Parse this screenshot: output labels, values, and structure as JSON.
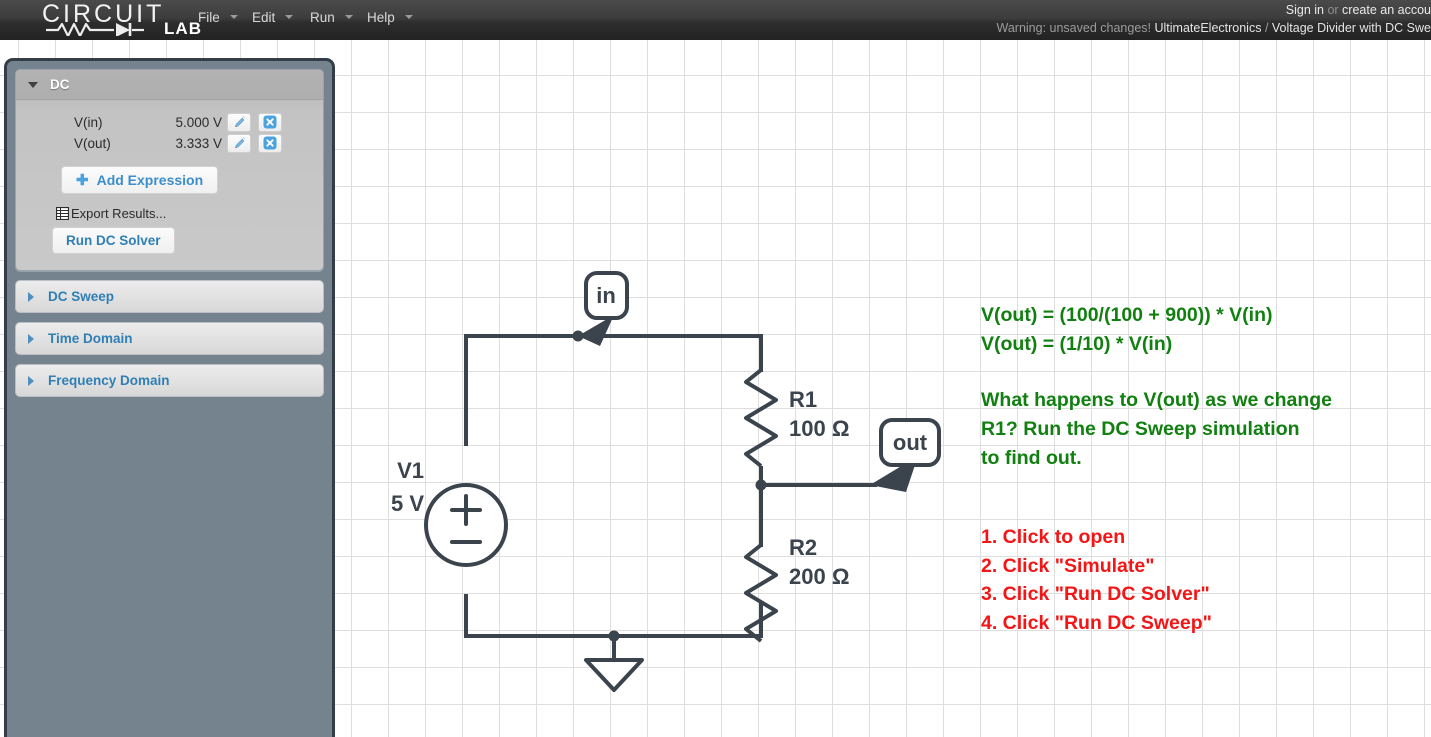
{
  "topbar": {
    "logo": {
      "word": "CIRCUIT",
      "lab": "LAB",
      "icon": "circuit-waveform-logo"
    },
    "menus": [
      {
        "name": "file",
        "label": "File"
      },
      {
        "name": "edit",
        "label": "Edit"
      },
      {
        "name": "run",
        "label": "Run"
      },
      {
        "name": "help",
        "label": "Help"
      }
    ],
    "account": {
      "sign_in": "Sign in",
      "or": " or ",
      "create": "create an accou"
    },
    "breadcrumb": {
      "warning": "Warning: unsaved changes!",
      "project": "UltimateElectronics",
      "separator": " / ",
      "document": "Voltage Divider with DC Swe"
    }
  },
  "sidebar": {
    "dc_panel": {
      "title": "DC",
      "collapse_icon": "triangle-down-icon",
      "results": [
        {
          "name": "V(in)",
          "value": "5.000 V",
          "edit_icon": "pencil-icon",
          "delete_icon": "circle-x-icon"
        },
        {
          "name": "V(out)",
          "value": "3.333 V",
          "edit_icon": "pencil-icon",
          "delete_icon": "circle-x-icon"
        }
      ],
      "add_expression": "Add Expression",
      "add_icon": "plus-icon",
      "export_results": "Export Results...",
      "export_icon": "table-icon",
      "run_button": "Run DC Solver"
    },
    "accordion": [
      {
        "name": "dc-sweep",
        "label": "DC Sweep",
        "expand_icon": "triangle-right-icon"
      },
      {
        "name": "time-domain",
        "label": "Time Domain",
        "expand_icon": "triangle-right-icon"
      },
      {
        "name": "frequency-domain",
        "label": "Frequency Domain",
        "expand_icon": "triangle-right-icon"
      }
    ]
  },
  "schematic": {
    "source": {
      "ref": "V1",
      "value": "5 V",
      "symbol": "voltage-source-circle",
      "plus": "+",
      "minus": "−"
    },
    "resistors": [
      {
        "ref": "R1",
        "value": "100 Ω"
      },
      {
        "ref": "R2",
        "value": "200 Ω"
      }
    ],
    "node_labels": [
      {
        "name": "in",
        "text": "in"
      },
      {
        "name": "out",
        "text": "out"
      }
    ],
    "ground": {
      "symbol": "ground-triangle"
    },
    "wire_color": "#3b444d"
  },
  "annotations": {
    "green_block_1": "V(out) = (100/(100 + 900)) * V(in)\nV(out) = (1/10) * V(in)",
    "green_block_2": "What happens to V(out) as we change\nR1? Run the DC Sweep simulation\nto find out.",
    "red_steps": "1. Click to open\n2. Click \"Simulate\"\n3. Click \"Run DC Solver\"\n4. Click \"Run DC Sweep\"",
    "green_color": "#118011",
    "red_color": "#f41616"
  }
}
